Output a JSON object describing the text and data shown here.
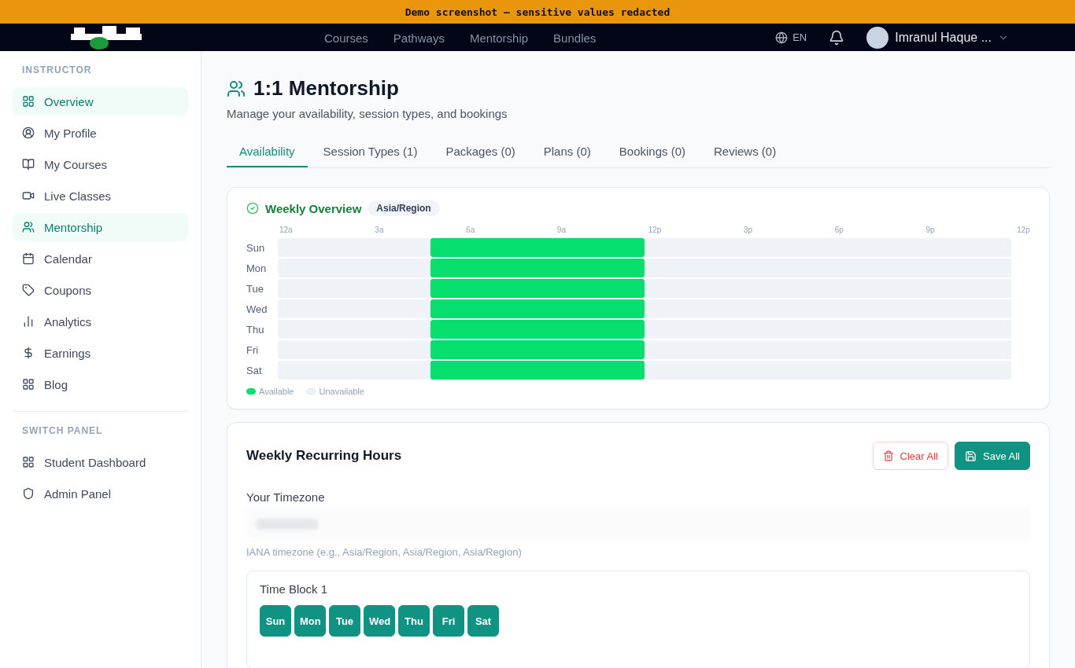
{
  "banner": "Demo screenshot — sensitive values redacted",
  "nav": {
    "links": [
      "Courses",
      "Pathways",
      "Mentorship",
      "Bundles"
    ],
    "language": "EN",
    "user_name": "Imranul Haque ..."
  },
  "sidebar": {
    "sections": [
      {
        "title": "INSTRUCTOR",
        "items": [
          {
            "label": "Overview",
            "kind": "grid",
            "selected": true
          },
          {
            "label": "My Profile",
            "kind": "user",
            "selected": false
          },
          {
            "label": "My Courses",
            "kind": "book",
            "selected": false
          },
          {
            "label": "Live Classes",
            "kind": "video",
            "selected": false
          },
          {
            "label": "Mentorship",
            "kind": "users",
            "selected": true
          },
          {
            "label": "Calendar",
            "kind": "calendar",
            "selected": false
          },
          {
            "label": "Coupons",
            "kind": "tag",
            "selected": false
          },
          {
            "label": "Analytics",
            "kind": "chart",
            "selected": false
          },
          {
            "label": "Earnings",
            "kind": "dollar",
            "selected": false
          },
          {
            "label": "Blog",
            "kind": "grid",
            "selected": false
          }
        ]
      },
      {
        "title": "SWITCH PANEL",
        "items": [
          {
            "label": "Student Dashboard",
            "kind": "grid",
            "selected": false
          },
          {
            "label": "Admin Panel",
            "kind": "shield",
            "selected": false
          }
        ]
      }
    ]
  },
  "page": {
    "title": "1:1 Mentorship",
    "subtitle": "Manage your availability, session types, and bookings"
  },
  "tabs": [
    {
      "label": "Availability",
      "selected": true
    },
    {
      "label": "Session Types (1)",
      "selected": false
    },
    {
      "label": "Packages (0)",
      "selected": false
    },
    {
      "label": "Plans (0)",
      "selected": false
    },
    {
      "label": "Bookings (0)",
      "selected": false
    },
    {
      "label": "Reviews (0)",
      "selected": false
    }
  ],
  "overview": {
    "title": "Weekly Overview",
    "timezone": "Asia/Region",
    "hour_labels": [
      "12a",
      "3a",
      "6a",
      "9a",
      "12p",
      "3p",
      "6p",
      "9p",
      "12p"
    ],
    "days": [
      {
        "label": "Sun",
        "hours": [
          false,
          false,
          false,
          false,
          false,
          true,
          true,
          true,
          true,
          true,
          true,
          true,
          false,
          false,
          false,
          false,
          false,
          false,
          false,
          false,
          false,
          false,
          false,
          false
        ]
      },
      {
        "label": "Mon",
        "hours": [
          false,
          false,
          false,
          false,
          false,
          true,
          true,
          true,
          true,
          true,
          true,
          true,
          false,
          false,
          false,
          false,
          false,
          false,
          false,
          false,
          false,
          false,
          false,
          false
        ]
      },
      {
        "label": "Tue",
        "hours": [
          false,
          false,
          false,
          false,
          false,
          true,
          true,
          true,
          true,
          true,
          true,
          true,
          false,
          false,
          false,
          false,
          false,
          false,
          false,
          false,
          false,
          false,
          false,
          false
        ]
      },
      {
        "label": "Wed",
        "hours": [
          false,
          false,
          false,
          false,
          false,
          true,
          true,
          true,
          true,
          true,
          true,
          true,
          false,
          false,
          false,
          false,
          false,
          false,
          false,
          false,
          false,
          false,
          false,
          false
        ]
      },
      {
        "label": "Thu",
        "hours": [
          false,
          false,
          false,
          false,
          false,
          true,
          true,
          true,
          true,
          true,
          true,
          true,
          false,
          false,
          false,
          false,
          false,
          false,
          false,
          false,
          false,
          false,
          false,
          false
        ]
      },
      {
        "label": "Fri",
        "hours": [
          false,
          false,
          false,
          false,
          false,
          true,
          true,
          true,
          true,
          true,
          true,
          true,
          false,
          false,
          false,
          false,
          false,
          false,
          false,
          false,
          false,
          false,
          false,
          false
        ]
      },
      {
        "label": "Sat",
        "hours": [
          false,
          false,
          false,
          false,
          false,
          true,
          true,
          true,
          true,
          true,
          true,
          true,
          false,
          false,
          false,
          false,
          false,
          false,
          false,
          false,
          false,
          false,
          false,
          false
        ]
      }
    ],
    "legend": [
      "Available",
      "Unavailable"
    ]
  },
  "recurring": {
    "title": "Weekly Recurring Hours",
    "clear_button": "Clear All",
    "save_button": "Save All",
    "timezone_label": "Your Timezone",
    "timezone_hint": "IANA timezone (e.g., Asia/Region, Asia/Region, Asia/Region)",
    "blocks": [
      {
        "title": "Time Block 1",
        "days": [
          {
            "label": "Sun",
            "selected": true
          },
          {
            "label": "Mon",
            "selected": true
          },
          {
            "label": "Tue",
            "selected": true
          },
          {
            "label": "Wed",
            "selected": true
          },
          {
            "label": "Thu",
            "selected": true
          },
          {
            "label": "Fri",
            "selected": true
          },
          {
            "label": "Sat",
            "selected": true
          }
        ]
      }
    ]
  }
}
